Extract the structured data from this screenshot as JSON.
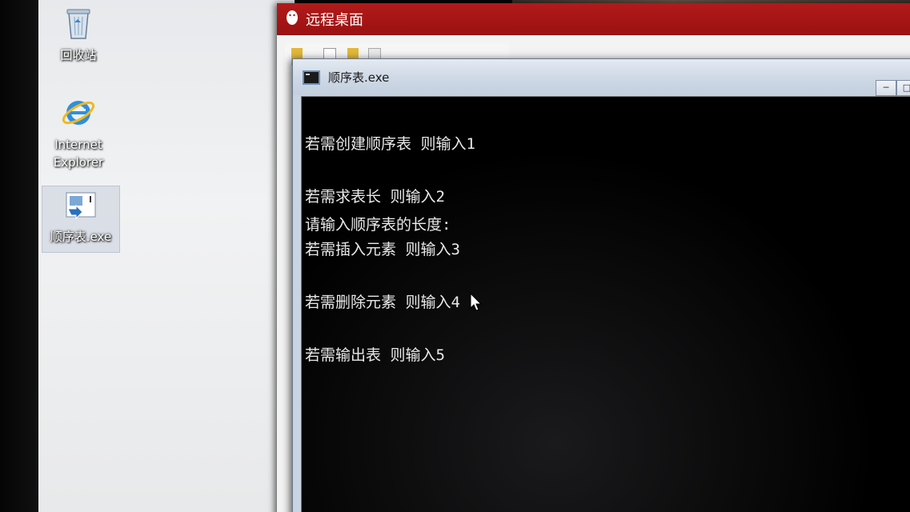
{
  "desktop": {
    "icons": [
      {
        "label": "回收站",
        "icon": "recycle-bin-icon"
      },
      {
        "label": "Internet\nExplorer",
        "label_line1": "Internet",
        "label_line2": "Explorer",
        "icon": "internet-explorer-icon"
      },
      {
        "label": "顺序表.exe",
        "icon": "exe-shortcut-icon"
      }
    ]
  },
  "remote_window": {
    "title": "远程桌面",
    "accent": "#a61515"
  },
  "console_window": {
    "title": "顺序表.exe",
    "controls": [
      "minimize",
      "maximize"
    ],
    "lines": [
      "若需创建顺序表 则输入1",
      "若需求表长 则输入2",
      "若需插入元素 则输入3",
      "若需删除元素 则输入4",
      "若需输出表 则输入5"
    ],
    "prompt": "请输入顺序表的长度:"
  }
}
